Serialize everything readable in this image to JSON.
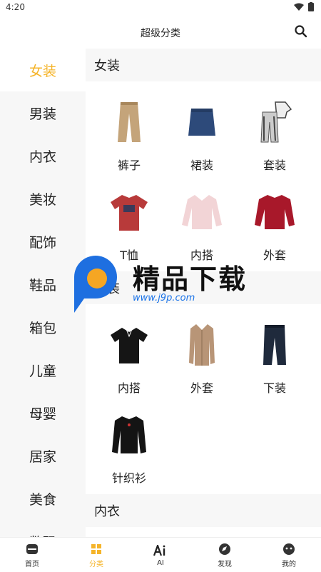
{
  "status": {
    "time": "4:20"
  },
  "header": {
    "title": "超级分类"
  },
  "sidebar": {
    "items": [
      {
        "label": "女装",
        "active": true
      },
      {
        "label": "男装"
      },
      {
        "label": "内衣"
      },
      {
        "label": "美妆"
      },
      {
        "label": "配饰"
      },
      {
        "label": "鞋品"
      },
      {
        "label": "箱包"
      },
      {
        "label": "儿童"
      },
      {
        "label": "母婴"
      },
      {
        "label": "居家"
      },
      {
        "label": "美食"
      },
      {
        "label": "数码"
      }
    ]
  },
  "sections": [
    {
      "title": "女装",
      "items": [
        {
          "label": "裤子",
          "icon": "trousers"
        },
        {
          "label": "裙装",
          "icon": "skirt"
        },
        {
          "label": "套装",
          "icon": "suit-set"
        },
        {
          "label": "T恤",
          "icon": "tshirt-red"
        },
        {
          "label": "内搭",
          "icon": "sweater-pink"
        },
        {
          "label": "外套",
          "icon": "sweater-red"
        }
      ]
    },
    {
      "title": "男装",
      "items": [
        {
          "label": "内搭",
          "icon": "polo-black"
        },
        {
          "label": "外套",
          "icon": "coat-camel"
        },
        {
          "label": "下装",
          "icon": "pants-navy"
        },
        {
          "label": "针织衫",
          "icon": "knit-black"
        }
      ]
    },
    {
      "title": "内衣",
      "items": []
    }
  ],
  "watermark": {
    "text": "精品下载",
    "url": "www.j9p.com"
  },
  "tabbar": {
    "items": [
      {
        "label": "首页",
        "icon": "home-icon"
      },
      {
        "label": "分类",
        "icon": "category-icon",
        "active": true
      },
      {
        "label": "AI",
        "icon": "ai-icon"
      },
      {
        "label": "发现",
        "icon": "compass-icon"
      },
      {
        "label": "我的",
        "icon": "profile-icon"
      }
    ]
  },
  "colors": {
    "accent": "#f5b42a",
    "sidebar_bg": "#f7f7f7"
  }
}
